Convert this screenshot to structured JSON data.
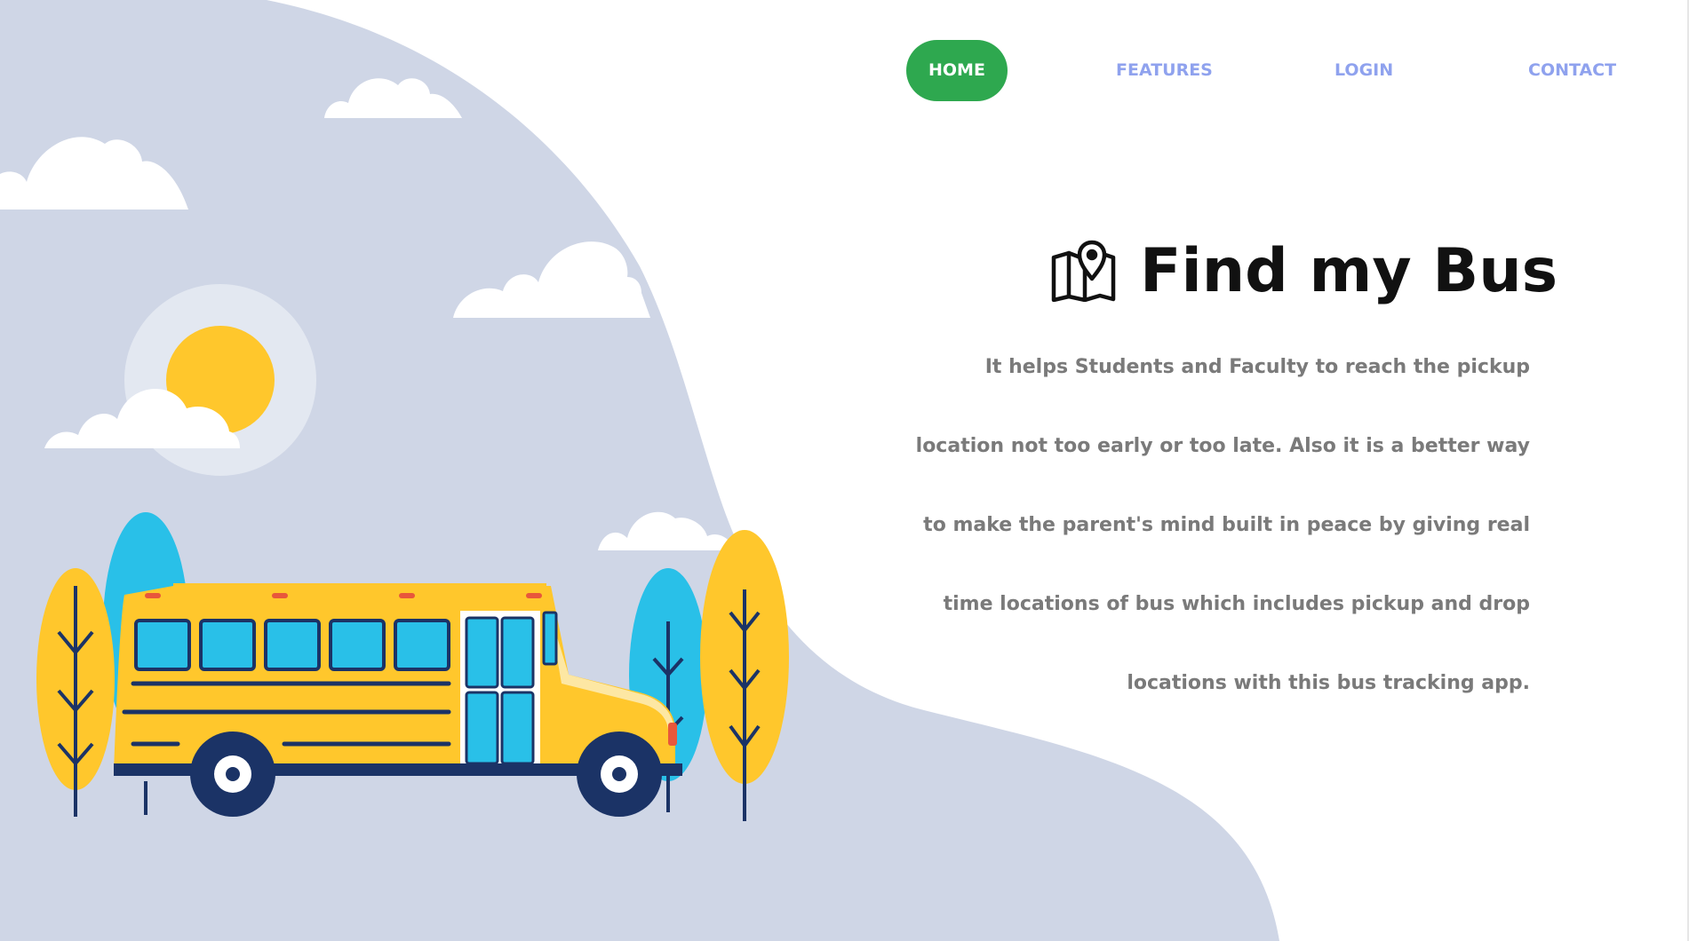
{
  "nav": {
    "items": [
      {
        "label": "HOME",
        "active": true
      },
      {
        "label": "FEATURES",
        "active": false
      },
      {
        "label": "LOGIN",
        "active": false
      },
      {
        "label": "CONTACT",
        "active": false
      }
    ]
  },
  "hero": {
    "title": "Find my Bus",
    "title_icon": "map-pin-icon",
    "description": "It helps Students and Faculty to reach the pickup location not too early or too late. Also it is a better way to make the parent's mind built in peace by giving real time locations of bus which includes pickup and drop locations with this bus tracking app."
  },
  "colors": {
    "accent_active": "#2ea84f",
    "nav_link": "#8fa2ee",
    "backdrop_blob": "#cfd6e6",
    "bus_yellow": "#ffc72c",
    "tree_blue": "#29c0e8",
    "navy": "#1b3366"
  }
}
